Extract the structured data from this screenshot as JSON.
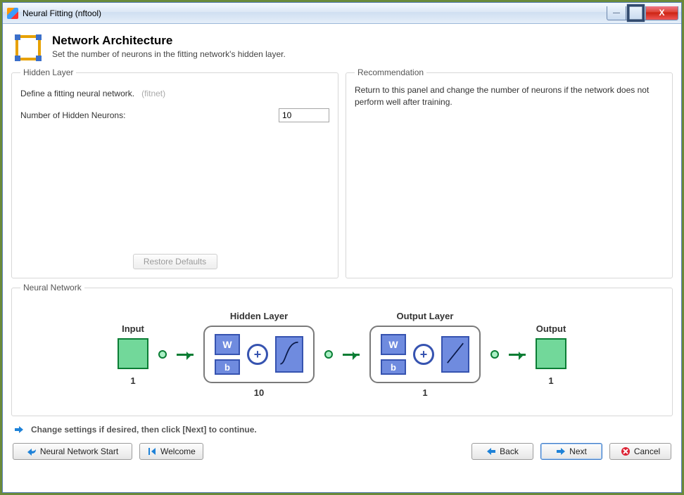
{
  "window": {
    "title": "Neural Fitting (nftool)"
  },
  "header": {
    "title": "Network Architecture",
    "subtitle": "Set the number of neurons in the fitting network's hidden layer."
  },
  "hidden_layer": {
    "legend": "Hidden Layer",
    "desc_main": "Define a fitting neural network.",
    "desc_ghost": "(fitnet)",
    "field_label": "Number of Hidden Neurons:",
    "field_value": "10",
    "restore": "Restore Defaults"
  },
  "recommendation": {
    "legend": "Recommendation",
    "text": "Return to this panel and change the number of neurons if the network does not perform well after training."
  },
  "network": {
    "legend": "Neural Network",
    "input_label": "Input",
    "input_size": "1",
    "hidden_title": "Hidden Layer",
    "hidden_size": "10",
    "output_title": "Output Layer",
    "output_size": "1",
    "output_label": "Output",
    "output_final_size": "1",
    "W": "W",
    "b": "b"
  },
  "hint": "Change settings  if desired, then click [Next] to continue.",
  "buttons": {
    "start": "Neural Network Start",
    "welcome": "Welcome",
    "back": "Back",
    "next": "Next",
    "cancel": "Cancel"
  }
}
